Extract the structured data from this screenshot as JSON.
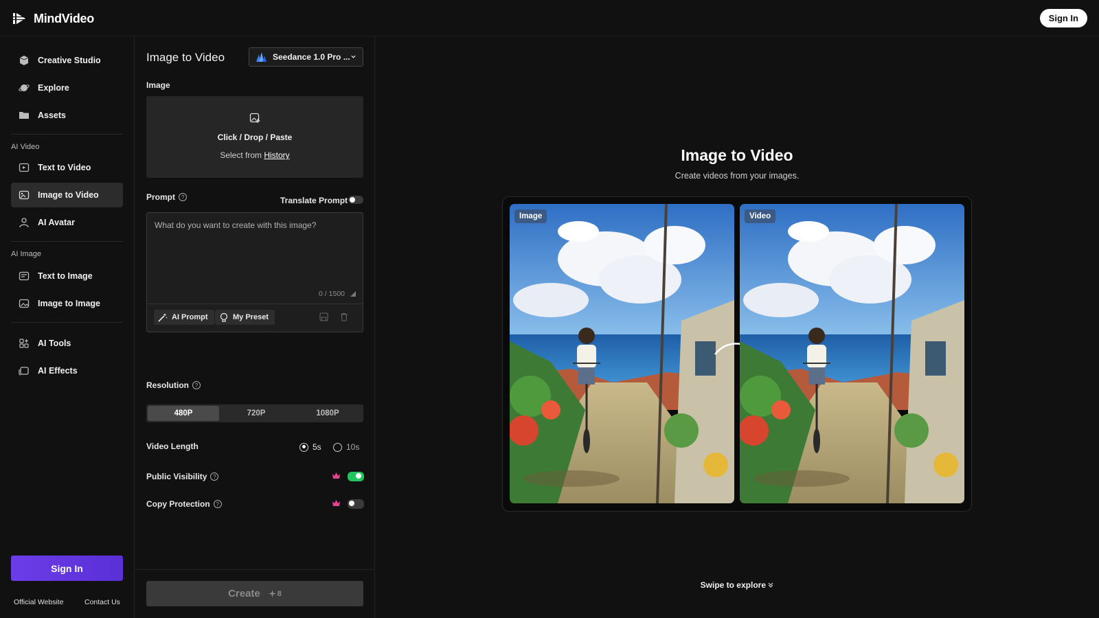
{
  "brand": {
    "name": "MindVideo"
  },
  "header": {
    "signin_label": "Sign In"
  },
  "sidebar": {
    "top_items": [
      {
        "label": "Creative Studio",
        "icon": "box-icon"
      },
      {
        "label": "Explore",
        "icon": "planet-icon"
      },
      {
        "label": "Assets",
        "icon": "folder-icon"
      }
    ],
    "section_video": "AI Video",
    "video_items": [
      {
        "label": "Text to Video",
        "icon": "text-video-icon"
      },
      {
        "label": "Image to Video",
        "icon": "image-video-icon",
        "active": true
      },
      {
        "label": "AI Avatar",
        "icon": "avatar-icon"
      }
    ],
    "section_image": "AI Image",
    "image_items": [
      {
        "label": "Text to Image",
        "icon": "text-image-icon"
      },
      {
        "label": "Image to Image",
        "icon": "image-image-icon"
      }
    ],
    "tool_items": [
      {
        "label": "AI Tools",
        "icon": "grid-plus-icon"
      },
      {
        "label": "AI Effects",
        "icon": "effects-icon"
      }
    ],
    "signin_label": "Sign In",
    "footer": {
      "official": "Official Website",
      "contact": "Contact Us"
    }
  },
  "panel": {
    "title": "Image to Video",
    "model": "Seedance 1.0 Pro ...",
    "image_label": "Image",
    "drop_main": "Click / Drop / Paste",
    "drop_sub_prefix": "Select from",
    "drop_sub_link": "History",
    "prompt_label": "Prompt",
    "translate_label": "Translate Prompt",
    "translate_on": false,
    "prompt_placeholder": "What do you want to create with this image?",
    "prompt_count": "0 / 1500",
    "ai_prompt_label": "AI Prompt",
    "my_preset_label": "My Preset",
    "resolution_label": "Resolution",
    "resolutions": [
      "480P",
      "720P",
      "1080P"
    ],
    "resolution_selected": "480P",
    "video_length_label": "Video Length",
    "lengths": [
      "5s",
      "10s"
    ],
    "length_selected": "5s",
    "public_visibility_label": "Public Visibility",
    "public_visibility_on": true,
    "copy_protection_label": "Copy Protection",
    "copy_protection_on": false,
    "create_label": "Create",
    "create_cost": "8"
  },
  "main": {
    "title": "Image to Video",
    "subtitle": "Create videos from your images.",
    "tag_image": "Image",
    "tag_video": "Video",
    "swipe_label": "Swipe to explore"
  },
  "colors": {
    "accent_purple": "#6a3de8",
    "toggle_on": "#22c55e",
    "crown": "#e84393"
  }
}
